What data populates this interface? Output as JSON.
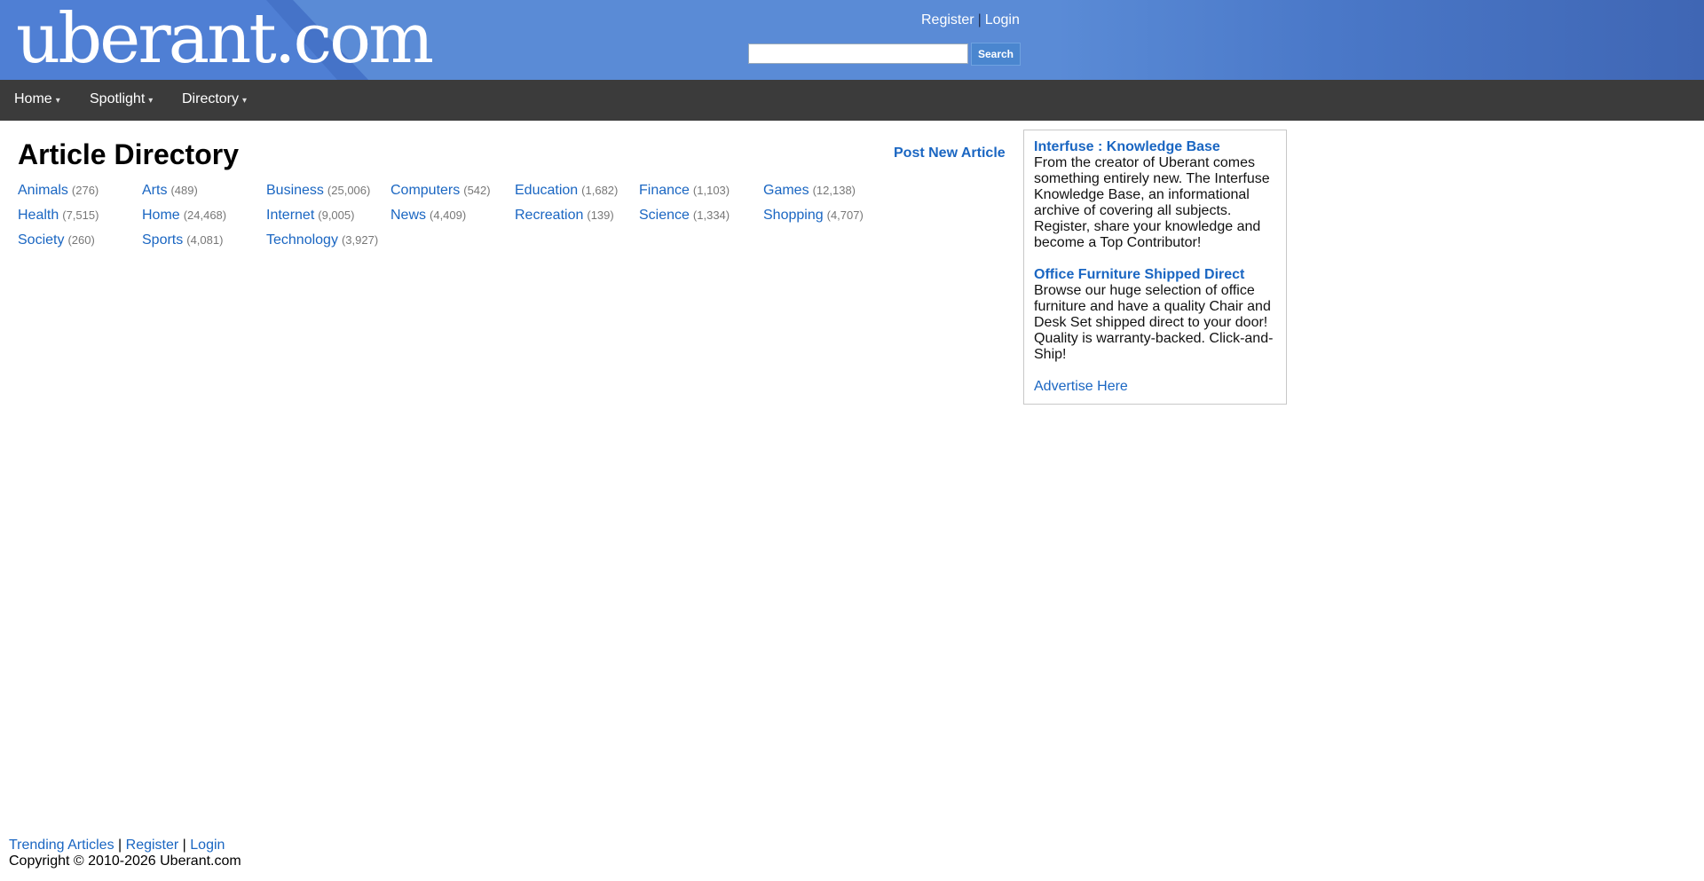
{
  "header": {
    "logo_text": "uberant.com",
    "register_label": "Register",
    "separator": "|",
    "login_label": "Login",
    "search_placeholder": "",
    "search_button": "Search"
  },
  "nav": {
    "items": [
      {
        "label": "Home",
        "icon": "chevron-down-icon"
      },
      {
        "label": "Spotlight",
        "icon": "chevron-down-icon"
      },
      {
        "label": "Directory",
        "icon": "chevron-down-icon"
      }
    ]
  },
  "main": {
    "title": "Article Directory",
    "post_new": "Post New Article",
    "categories": [
      {
        "name": "Animals",
        "count": "(276)"
      },
      {
        "name": "Arts",
        "count": "(489)"
      },
      {
        "name": "Business",
        "count": "(25,006)"
      },
      {
        "name": "Computers",
        "count": "(542)"
      },
      {
        "name": "Education",
        "count": "(1,682)"
      },
      {
        "name": "Finance",
        "count": "(1,103)"
      },
      {
        "name": "Games",
        "count": "(12,138)"
      },
      {
        "name": "Health",
        "count": "(7,515)"
      },
      {
        "name": "Home",
        "count": "(24,468)"
      },
      {
        "name": "Internet",
        "count": "(9,005)"
      },
      {
        "name": "News",
        "count": "(4,409)"
      },
      {
        "name": "Recreation",
        "count": "(139)"
      },
      {
        "name": "Science",
        "count": "(1,334)"
      },
      {
        "name": "Shopping",
        "count": "(4,707)"
      },
      {
        "name": "Society",
        "count": "(260)"
      },
      {
        "name": "Sports",
        "count": "(4,081)"
      },
      {
        "name": "Technology",
        "count": "(3,927)"
      }
    ]
  },
  "sidebar": {
    "ads": [
      {
        "title": "Interfuse : Knowledge Base",
        "body": "From the creator of Uberant comes something entirely new. The Interfuse Knowledge Base, an informational archive of covering all subjects. Register, share your knowledge and become a Top Contributor!"
      },
      {
        "title": "Office Furniture Shipped Direct",
        "body": "Browse our huge selection of office furniture and have a quality Chair and Desk Set shipped direct to your door! Quality is warranty-backed. Click-and-Ship!"
      }
    ],
    "advertise_link": "Advertise Here"
  },
  "footer": {
    "trending": "Trending Articles",
    "separator": "|",
    "register": "Register",
    "login": "Login",
    "copyright": "Copyright © 2010-2026 Uberant.com"
  },
  "colors": {
    "header_blue": "#5a8bd6",
    "nav_dark": "#3b3b3b",
    "link_blue": "#1a66c2",
    "count_gray": "#777777"
  }
}
